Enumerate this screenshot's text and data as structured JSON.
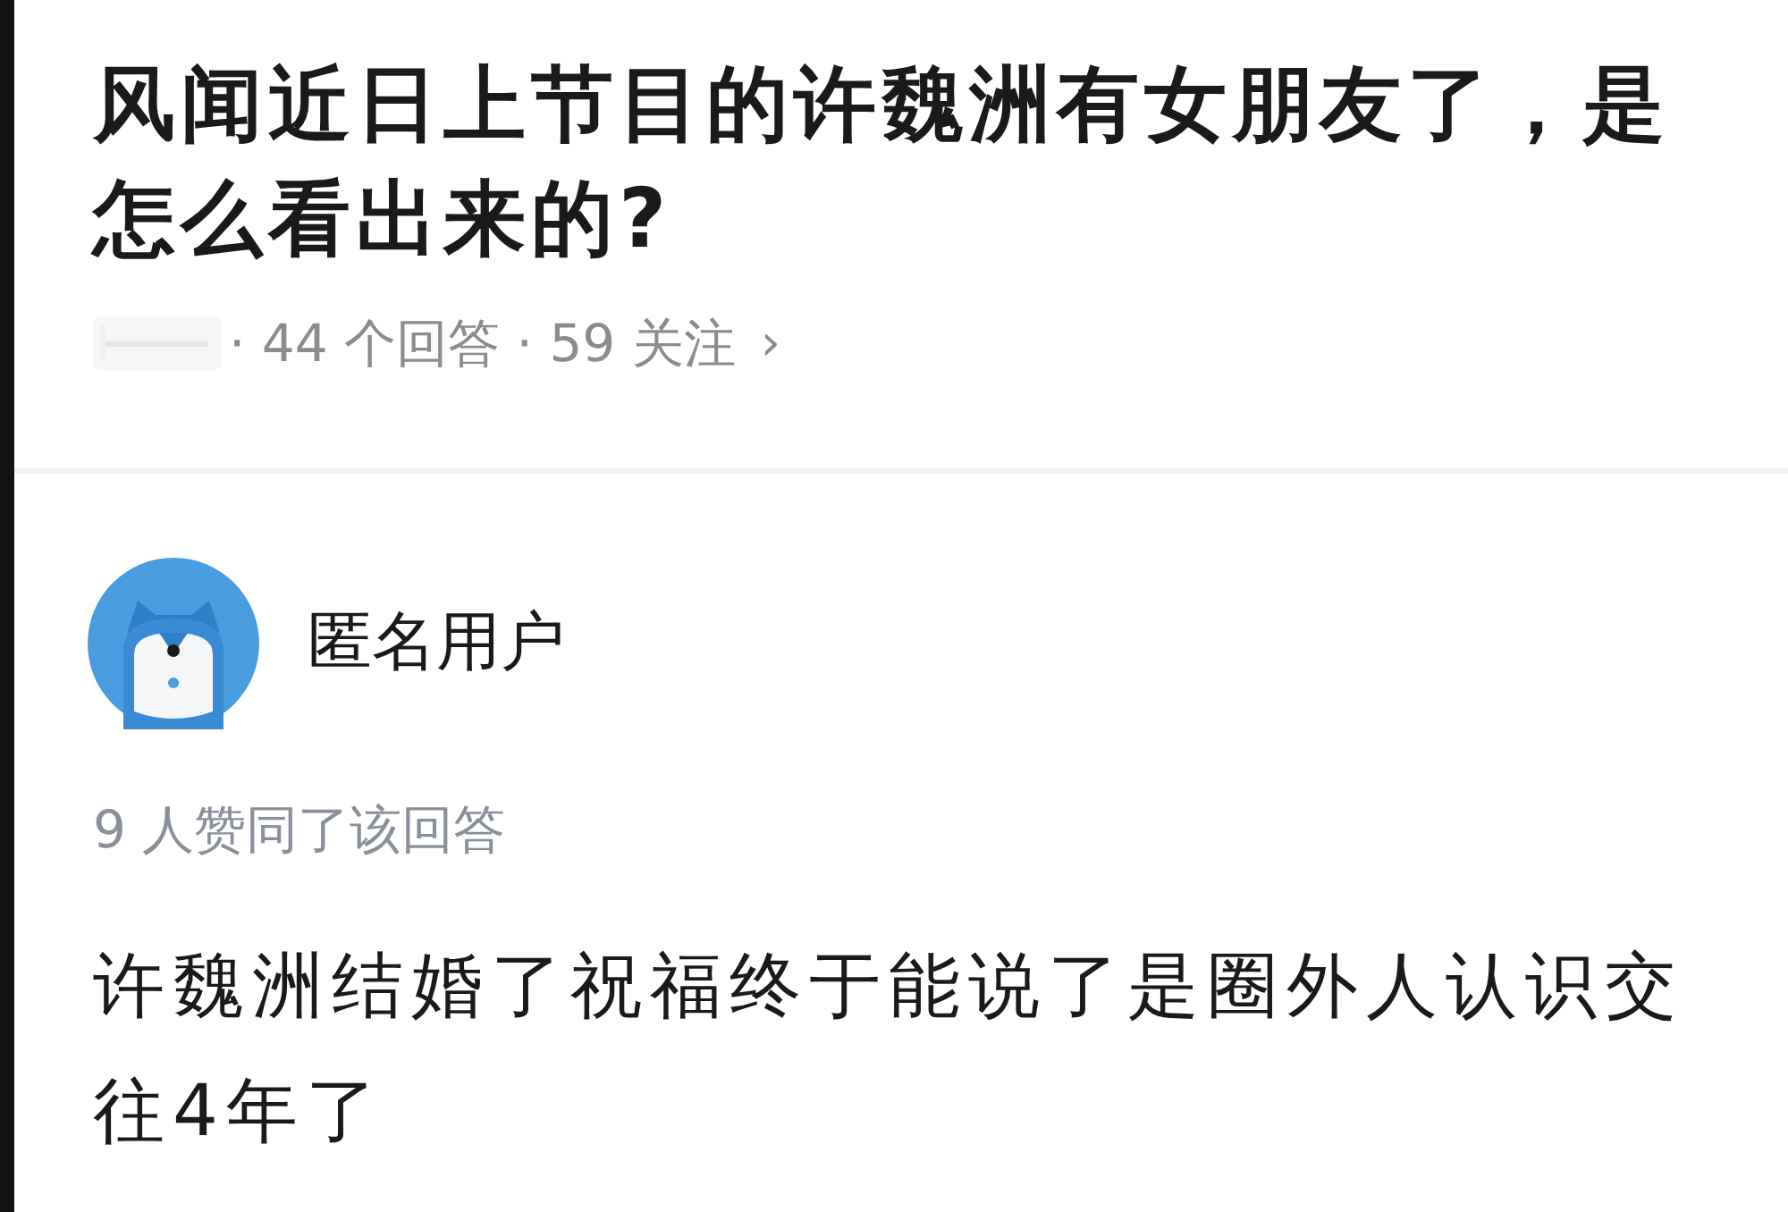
{
  "question": {
    "title": "风闻近日上节目的许魏洲有女朋友了，是怎么看出来的?",
    "meta": "· 44 个回答 · 59 关注",
    "chevron": "›"
  },
  "answer": {
    "author": {
      "name": "匿名用户"
    },
    "upvotes": "9 人赞同了该回答",
    "text": "许魏洲结婚了祝福终于能说了是圈外人认识交往4年了"
  }
}
